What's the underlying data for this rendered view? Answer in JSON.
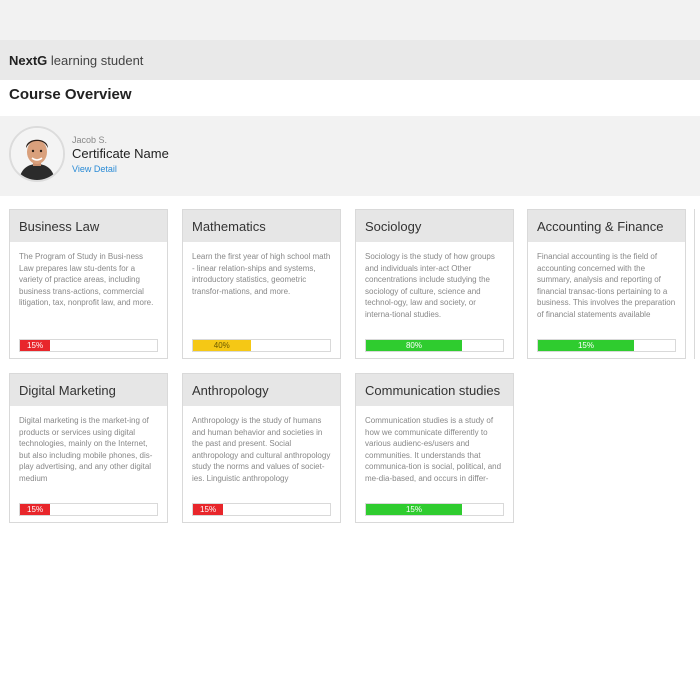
{
  "app": {
    "brand_bold": "NextG",
    "brand_rest": " learning student"
  },
  "page": {
    "title": "Course Overview"
  },
  "profile": {
    "name": "Jacob S.",
    "certificate": "Certificate Name",
    "link": "View Detail"
  },
  "colors": {
    "red": "#e8262b",
    "yellow": "#f5c815",
    "green": "#2fcc2f"
  },
  "courses": [
    {
      "title": "Business Law",
      "description": "The Program of Study in Busi-ness Law prepares law stu-dents for a variety of practice areas, including business trans-actions, commercial litigation, tax, nonprofit law, and more.",
      "progress_label": "15%",
      "progress": 0.22,
      "bar_color": "#e8262b"
    },
    {
      "title": "Mathematics",
      "description": "Learn the first year of high school math - linear relation-ships and systems, introductory statistics, geometric transfor-mations, and more.",
      "progress_label": "40%",
      "progress": 0.42,
      "bar_color": "#f5c815"
    },
    {
      "title": "Sociology",
      "description": "Sociology is the study of how groups and individuals inter-act Other concentrations include studying the sociology of culture, science and technol-ogy, law and society, or interna-tional studies.",
      "progress_label": "80%",
      "progress": 0.7,
      "bar_color": "#2fcc2f"
    },
    {
      "title": "Accounting & Finance",
      "description": "Financial accounting is the field of accounting concerned with the summary, analysis and reporting of financial transac-tions pertaining to a business. This involves the preparation of financial statements available",
      "progress_label": "15%",
      "progress": 0.7,
      "bar_color": "#2fcc2f"
    },
    {
      "title": "Digital Marketing",
      "description": "Digital marketing is the market-ing of products or services using digital technologies, mainly on the Internet, but also including mobile phones, dis-play advertising, and any other digital medium",
      "progress_label": "15%",
      "progress": 0.22,
      "bar_color": "#e8262b"
    },
    {
      "title": "Anthropology",
      "description": "Anthropology is the study of humans and human behavior and societies in the past and present. Social anthropology and cultural anthropology study the norms and values of societ-ies. Linguistic anthropology",
      "progress_label": "15%",
      "progress": 0.22,
      "bar_color": "#e8262b"
    },
    {
      "title": "Communication studies",
      "description": "Communication studies is a study of how we communicate differently to various audienc-es/users and communities. It understands that communica-tion is social, political, and me-dia-based, and occurs in differ-",
      "progress_label": "15%",
      "progress": 0.7,
      "bar_color": "#2fcc2f"
    }
  ]
}
